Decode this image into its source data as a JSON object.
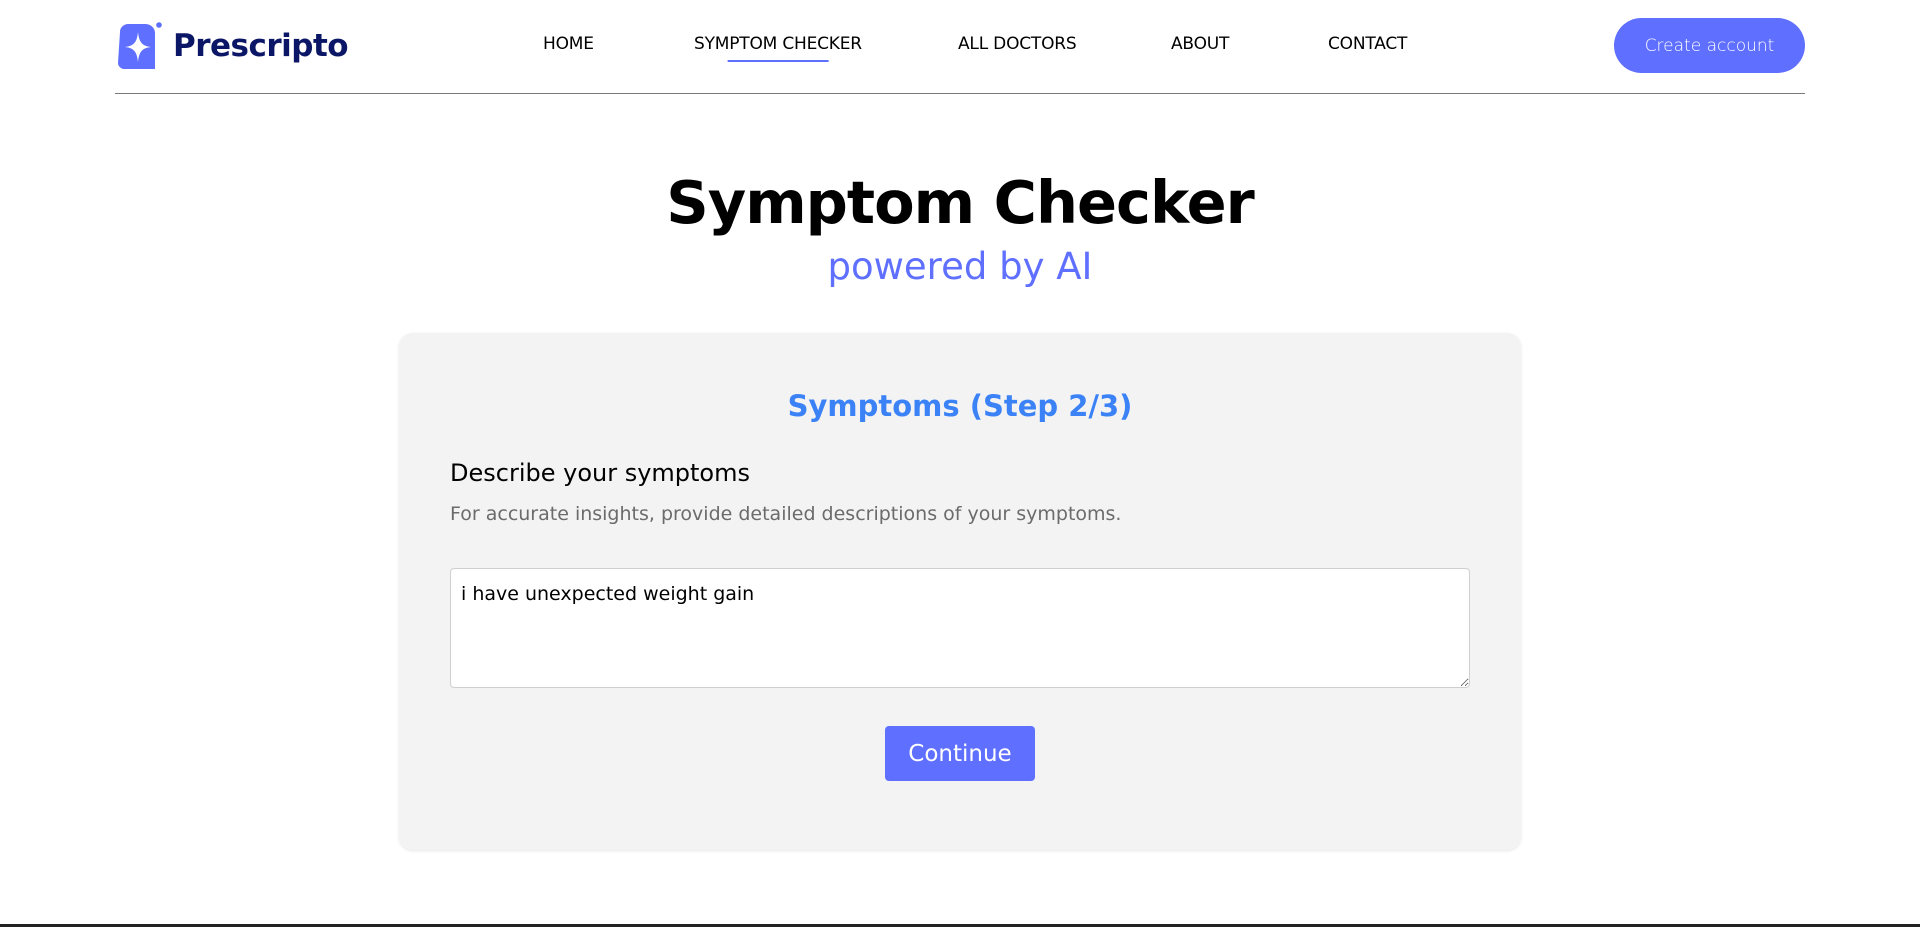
{
  "brand": {
    "name": "Prescripto",
    "logo_icon": "sparkle-star-icon",
    "accent_color": "#5f6fff",
    "text_color": "#0b1766"
  },
  "nav": {
    "items": [
      {
        "label": "HOME",
        "active": false
      },
      {
        "label": "SYMPTOM CHECKER",
        "active": true
      },
      {
        "label": "ALL DOCTORS",
        "active": false
      },
      {
        "label": "ABOUT",
        "active": false
      },
      {
        "label": "CONTACT",
        "active": false
      }
    ],
    "create_account_label": "Create account"
  },
  "hero": {
    "title": "Symptom Checker",
    "subtitle": "powered by AI"
  },
  "form": {
    "step_title": "Symptoms (Step 2/3)",
    "section_title": "Describe your symptoms",
    "section_description": "For accurate insights, provide detailed descriptions of your symptoms.",
    "symptoms_value": "i have unexpected weight gain",
    "continue_label": "Continue"
  }
}
